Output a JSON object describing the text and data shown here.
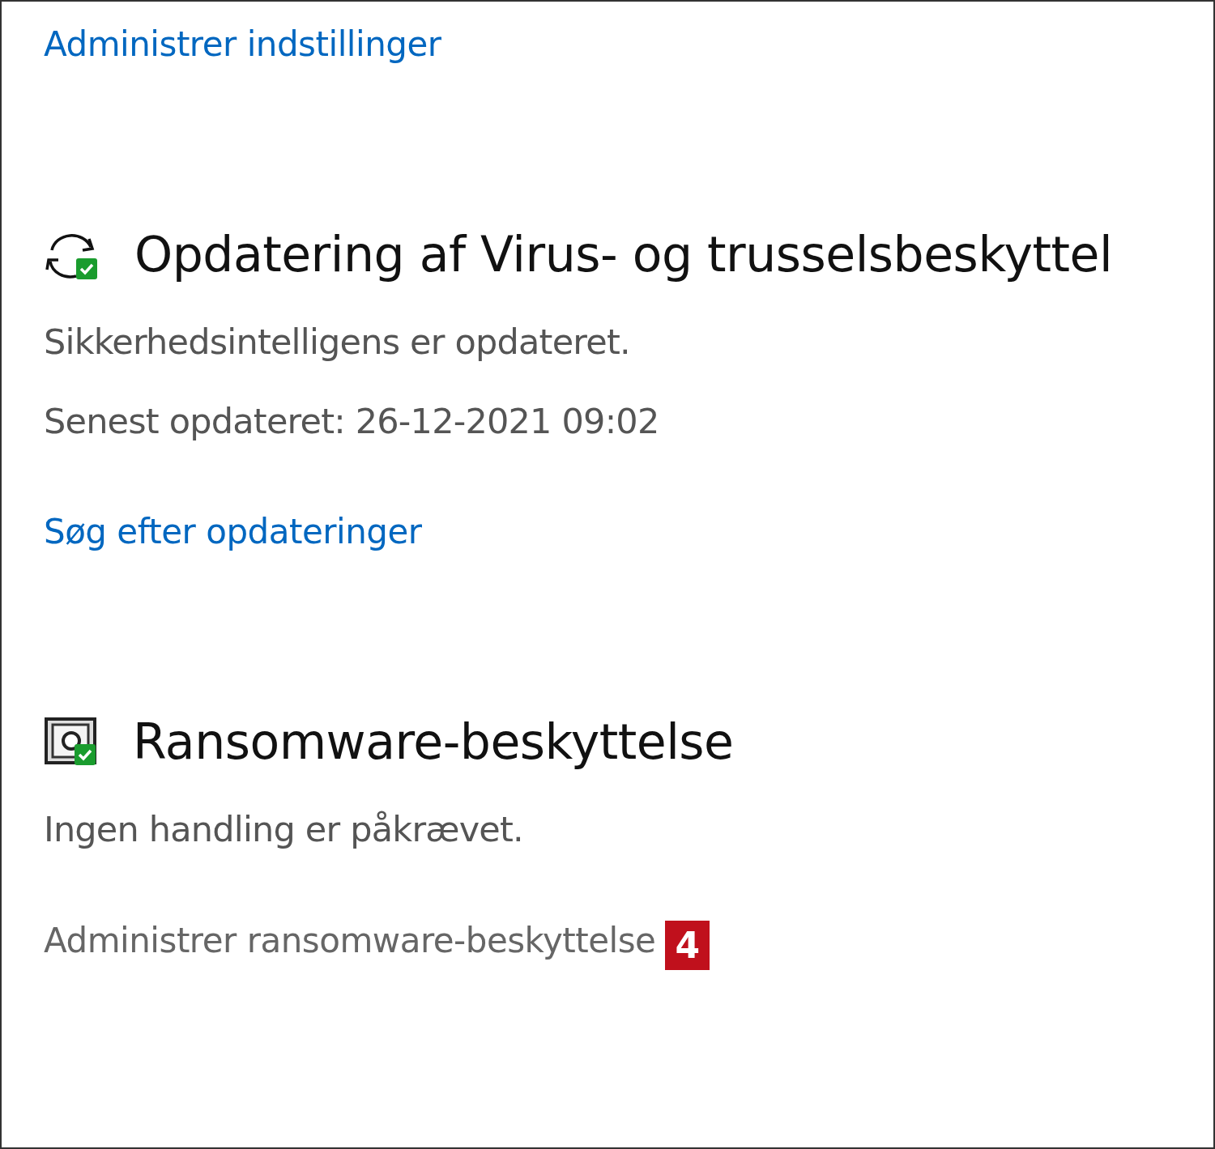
{
  "top_link": "Administrer indstillinger",
  "sections": [
    {
      "kind": "update",
      "title": "Opdatering af Virus- og trusselsbeskyttel",
      "lines": [
        "Sikkerhedsintelligens er opdateret.",
        "Senest opdateret: 26-12-2021 09:02"
      ],
      "link": {
        "text": "Søg efter opdateringer",
        "muted": false
      }
    },
    {
      "kind": "ransomware",
      "title": "Ransomware-beskyttelse",
      "lines": [
        "Ingen handling er påkrævet."
      ],
      "link": {
        "text": "Administrer ransomware-beskyttelse",
        "muted": true
      },
      "badge": "4"
    }
  ]
}
